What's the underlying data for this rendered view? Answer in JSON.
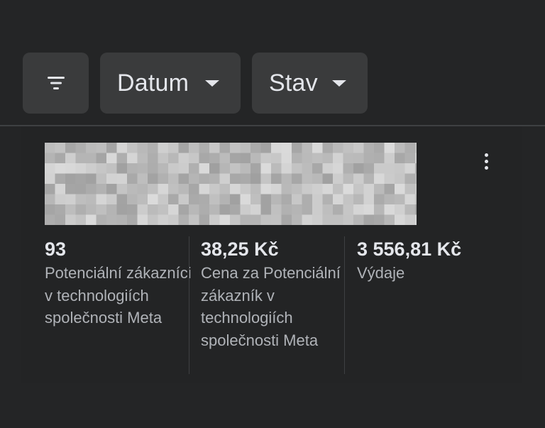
{
  "filters": {
    "filter_icon": "filter-lines-icon",
    "date_label": "Datum",
    "status_label": "Stav",
    "dropdown_icon": "caret-down-icon"
  },
  "card": {
    "thumbnail": "blurred-image-placeholder",
    "more_icon": "more-vertical-icon",
    "metrics": [
      {
        "value": "93",
        "label": "Potenciální zákazníci v technologiích společnosti Meta"
      },
      {
        "value": "38,25 Kč",
        "label": "Cena za Potenciální zákazník v technologiích společnosti Meta"
      },
      {
        "value": "3 556,81 Kč",
        "label": "Výdaje"
      }
    ]
  },
  "colors": {
    "background": "#242526",
    "chip": "#3a3b3c",
    "text_primary": "#e4e6eb",
    "text_secondary": "#b0b3b8",
    "divider": "#3e4042"
  }
}
